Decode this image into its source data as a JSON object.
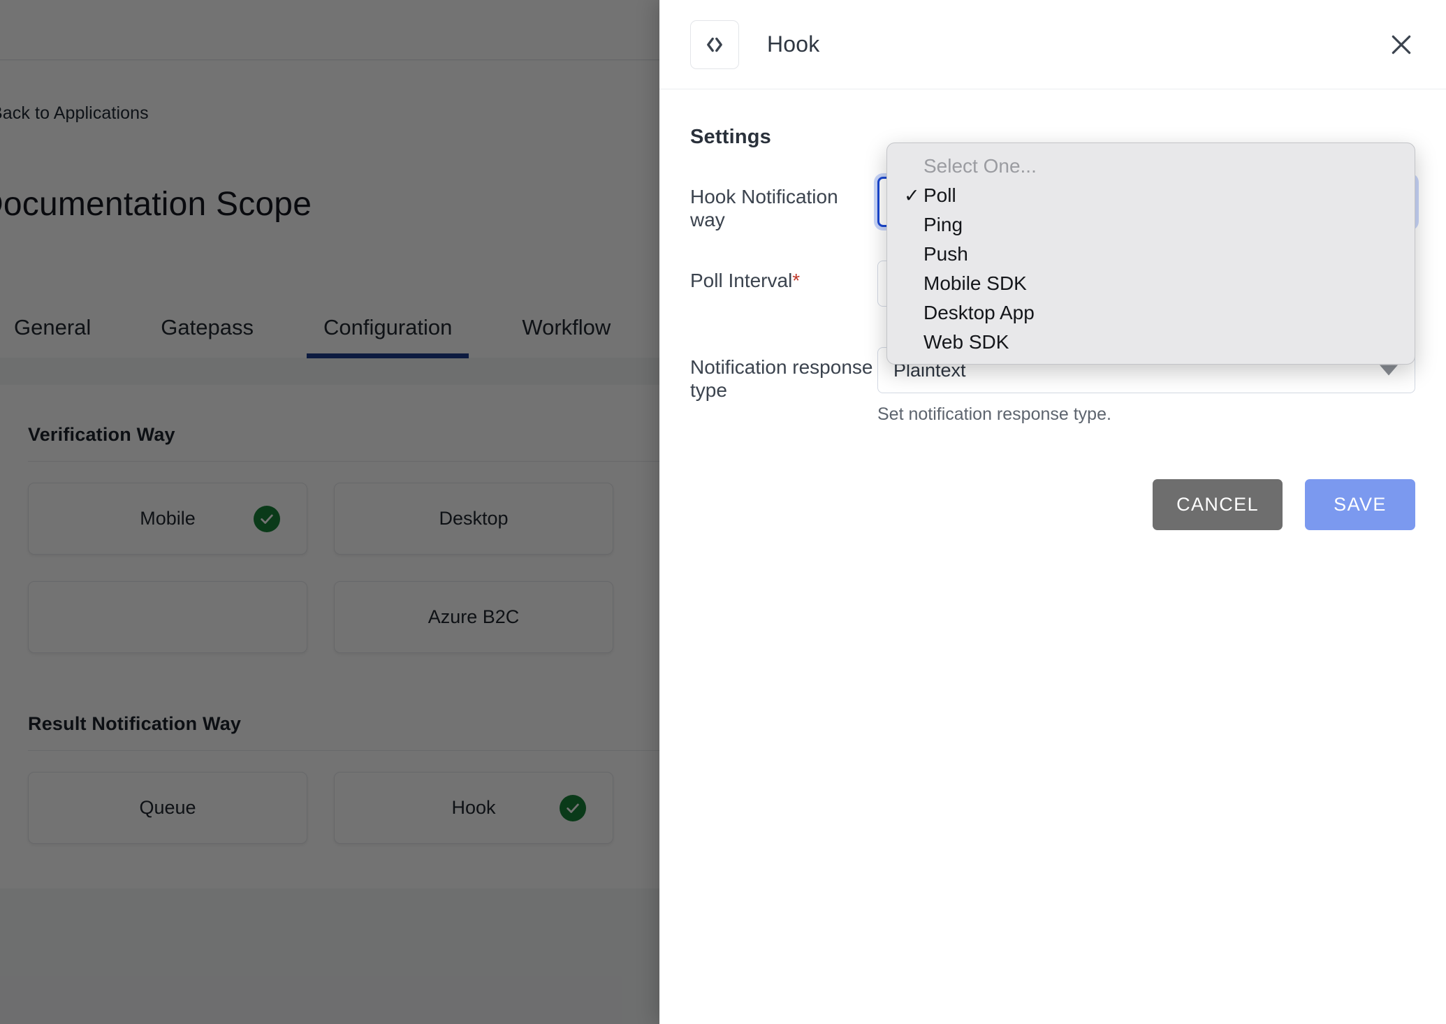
{
  "background": {
    "breadcrumb": "Back to Applications",
    "page_title": "Documentation Scope",
    "tabs": [
      {
        "label": "General",
        "active": false
      },
      {
        "label": "Gatepass",
        "active": false
      },
      {
        "label": "Configuration",
        "active": true
      },
      {
        "label": "Workflow",
        "active": false
      }
    ],
    "sections": [
      {
        "title": "Verification Way",
        "options": [
          {
            "label": "Mobile",
            "selected": true
          },
          {
            "label": "Desktop",
            "selected": false
          },
          {
            "label": "",
            "selected": false
          },
          {
            "label": "Azure B2C",
            "selected": false
          }
        ]
      },
      {
        "title": "Result Notification Way",
        "options": [
          {
            "label": "Queue",
            "selected": false
          },
          {
            "label": "Hook",
            "selected": true
          }
        ]
      }
    ]
  },
  "panel": {
    "icon": "code-brackets-icon",
    "title": "Hook",
    "close_icon": "close-icon",
    "settings_heading": "Settings",
    "fields": [
      {
        "label": "Hook Notification way",
        "required": false,
        "type": "select",
        "value": "Poll",
        "focused": true,
        "help": ""
      },
      {
        "label": "Poll Interval",
        "required": true,
        "type": "text",
        "value": "",
        "focused": false,
        "help": ""
      },
      {
        "label": "Notification response type",
        "required": false,
        "type": "select",
        "value": "Plaintext",
        "focused": false,
        "help": "Set notification response type."
      }
    ],
    "dropdown": {
      "placeholder": "Select One...",
      "selected": "Poll",
      "checkmark": "✓",
      "options": [
        "Poll",
        "Ping",
        "Push",
        "Mobile SDK",
        "Desktop App",
        "Web SDK"
      ]
    },
    "buttons": {
      "cancel": "CANCEL",
      "save": "SAVE"
    }
  },
  "colors": {
    "accent_blue": "#1a47d0",
    "save_blue": "#7b99ef",
    "cancel_grey": "#6e6e6e",
    "tab_underline": "#1e3d8f",
    "check_green": "#188038",
    "required_red": "#c0392b"
  }
}
